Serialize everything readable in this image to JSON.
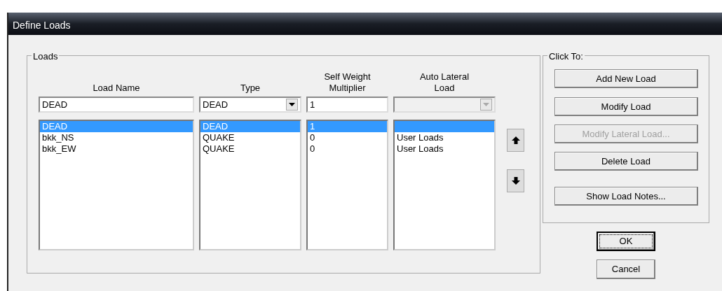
{
  "window": {
    "title": "Define Loads"
  },
  "loads_group": {
    "title": "Loads",
    "columns": [
      {
        "heading": "Load Name"
      },
      {
        "heading": "Type"
      },
      {
        "heading": "Self Weight Multiplier"
      },
      {
        "heading": "Auto Lateral Load"
      }
    ],
    "inputs": {
      "load_name": "DEAD",
      "type": "DEAD",
      "self_weight_multiplier": "1",
      "auto_lateral_load_disabled": true
    },
    "rows": [
      {
        "load_name": "DEAD",
        "type": "DEAD",
        "multiplier": "1",
        "auto_lateral": "",
        "selected": true
      },
      {
        "load_name": "bkk_NS",
        "type": "QUAKE",
        "multiplier": "0",
        "auto_lateral": "User Loads",
        "selected": false
      },
      {
        "load_name": "bkk_EW",
        "type": "QUAKE",
        "multiplier": "0",
        "auto_lateral": "User Loads",
        "selected": false
      }
    ]
  },
  "click_to_group": {
    "title": "Click To:",
    "buttons": [
      {
        "label": "Add New Load",
        "disabled": false
      },
      {
        "label": "Modify Load",
        "disabled": false
      },
      {
        "label": "Modify Lateral Load...",
        "disabled": true
      },
      {
        "label": "Delete Load",
        "disabled": false
      },
      {
        "label": "Show Load Notes...",
        "disabled": false
      }
    ]
  },
  "dialog_buttons": [
    {
      "label": "OK",
      "default": true
    },
    {
      "label": "Cancel",
      "default": false
    }
  ]
}
